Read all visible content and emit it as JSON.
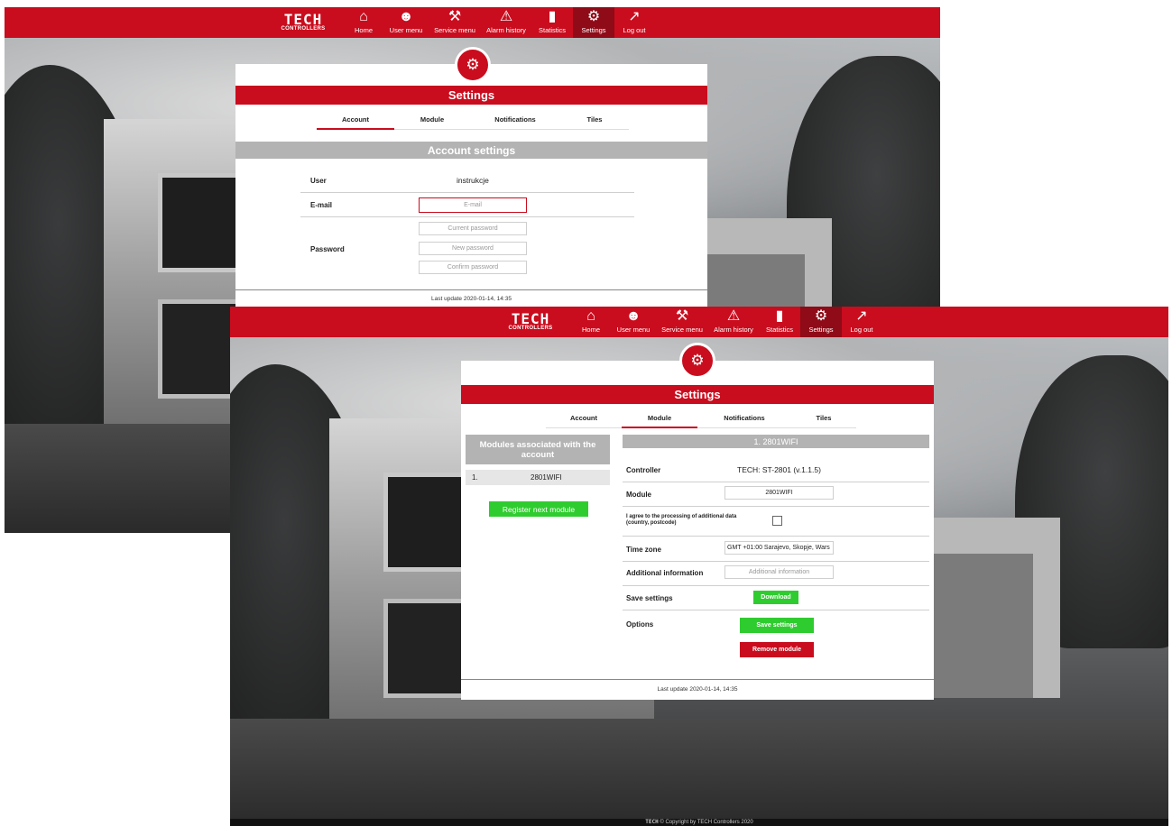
{
  "colors": {
    "brand_red": "#c90d1e",
    "active_nav": "#8e0b17",
    "grey_header": "#b3b3b3",
    "green_button": "#2fcc2f"
  },
  "nav": {
    "logo_main": "TECH",
    "logo_sub": "CONTROLLERS",
    "items": [
      {
        "label": "Home",
        "icon": "home-icon"
      },
      {
        "label": "User menu",
        "icon": "user-menu-icon"
      },
      {
        "label": "Service menu",
        "icon": "service-menu-icon"
      },
      {
        "label": "Alarm history",
        "icon": "alarm-icon"
      },
      {
        "label": "Statistics",
        "icon": "statistics-icon"
      },
      {
        "label": "Settings",
        "icon": "settings-sliders-icon",
        "active": true
      },
      {
        "label": "Log out",
        "icon": "logout-icon"
      }
    ]
  },
  "settings_title": "Settings",
  "tabs": [
    "Account",
    "Module",
    "Notifications",
    "Tiles"
  ],
  "account": {
    "section_title": "Account settings",
    "user_label": "User",
    "user_value": "instrukcje",
    "email_label": "E-mail",
    "email_placeholder": "E-mail",
    "password_label": "Password",
    "current_password_placeholder": "Current password",
    "new_password_placeholder": "New password",
    "confirm_password_placeholder": "Confirm password",
    "last_update": "Last update 2020-01-14, 14:35"
  },
  "module": {
    "list_title": "Modules associated with the account",
    "list_items": [
      {
        "index": "1.",
        "name": "2801WIFI"
      }
    ],
    "register_button": "Register next module",
    "detail_title": "1. 2801WIFI",
    "controller_label": "Controller",
    "controller_value": "TECH: ST-2801 (v.1.1.5)",
    "module_label": "Module",
    "module_value": "2801WIFI",
    "consent_label": "I agree to the processing of additional data (country, postcode)",
    "consent_checked": false,
    "timezone_label": "Time zone",
    "timezone_value": "GMT +01:00 Sarajevo, Skopje, Wars",
    "additional_label": "Additional information",
    "additional_placeholder": "Additional information",
    "save_settings_label": "Save settings",
    "download_button": "Download",
    "options_label": "Options",
    "save_settings_button": "Save settings",
    "remove_module_button": "Remove module",
    "last_update": "Last update 2020-01-14, 14:35"
  },
  "copyright": "© Copyright by TECH Controllers 2020",
  "copyright_logo": "TECH"
}
